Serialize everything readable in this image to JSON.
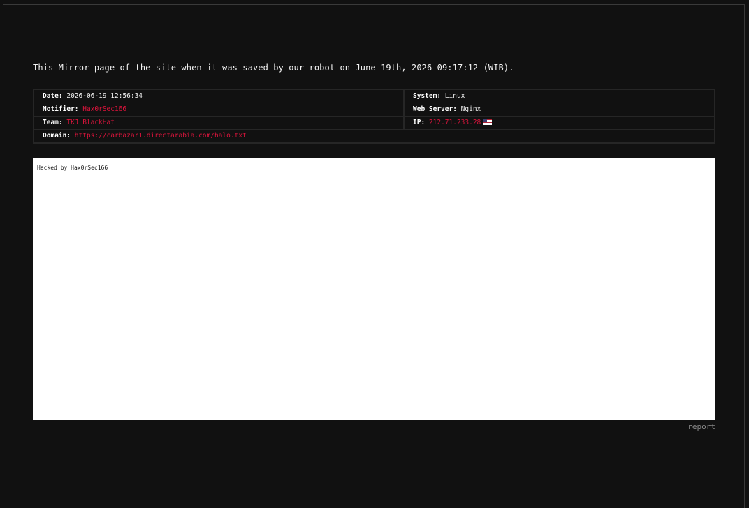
{
  "intro_text": "This Mirror page of the site when it was saved by our robot on June 19th, 2026 09:17:12 (WIB).",
  "info": {
    "date_label": "Date:",
    "date_value": "2026-06-19 12:56:34",
    "system_label": "System:",
    "system_value": "Linux",
    "notifier_label": "Notifier:",
    "notifier_value": "Hax0rSec166",
    "webserver_label": "Web Server:",
    "webserver_value": "Nginx",
    "team_label": "Team:",
    "team_value": "TKJ BlackHat",
    "ip_label": "IP:",
    "ip_value": "212.71.233.28",
    "ip_flag_icon": "us-flag-icon",
    "domain_label": "Domain:",
    "domain_value": "https://carbazar1.directarabia.com/halo.txt"
  },
  "mirror": {
    "content_text": "Hacked by Hax0rSec166"
  },
  "report_label": "report",
  "colors": {
    "background": "#111111",
    "accent_red": "#dc143c",
    "mirror_background": "#ffffff",
    "report_gray": "#8a8a8a"
  }
}
